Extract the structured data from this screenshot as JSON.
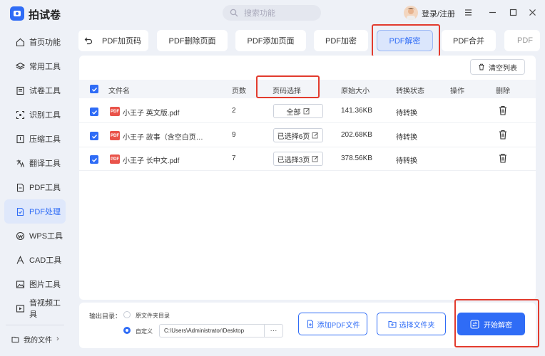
{
  "app": {
    "title": "拍试卷",
    "search_placeholder": "搜索功能",
    "login": "登录/注册"
  },
  "sidebar": {
    "items": [
      {
        "label": "首页功能",
        "icon": "home-icon"
      },
      {
        "label": "常用工具",
        "icon": "layers-icon"
      },
      {
        "label": "试卷工具",
        "icon": "exam-icon"
      },
      {
        "label": "识别工具",
        "icon": "scan-icon"
      },
      {
        "label": "压缩工具",
        "icon": "compress-icon"
      },
      {
        "label": "翻译工具",
        "icon": "translate-icon"
      },
      {
        "label": "PDF工具",
        "icon": "pdf-icon"
      },
      {
        "label": "PDF处理",
        "icon": "pdf-process-icon"
      },
      {
        "label": "WPS工具",
        "icon": "wps-icon"
      },
      {
        "label": "CAD工具",
        "icon": "cad-icon"
      },
      {
        "label": "图片工具",
        "icon": "image-icon"
      },
      {
        "label": "音视频工具",
        "icon": "media-icon"
      }
    ],
    "active_index": 7,
    "my_files": "我的文件"
  },
  "tabs": [
    "PDF加页码",
    "PDF删除页面",
    "PDF添加页面",
    "PDF加密",
    "PDF解密",
    "PDF合并",
    "PDF"
  ],
  "active_tab": 4,
  "panel": {
    "clear_label": "清空列表",
    "headers": {
      "name": "文件名",
      "pages": "页数",
      "page_select": "页码选择",
      "size": "原始大小",
      "status": "转换状态",
      "action": "操作",
      "delete": "删除"
    },
    "rows": [
      {
        "name": "小王子 英文版.pdf",
        "pages": "2",
        "page_select": "全部",
        "size": "141.36KB",
        "status": "待转换"
      },
      {
        "name": "小王子 故事（含空白页…",
        "pages": "9",
        "page_select": "已选择6页",
        "size": "202.68KB",
        "status": "待转换"
      },
      {
        "name": "小王子 长中文.pdf",
        "pages": "7",
        "page_select": "已选择3页",
        "size": "378.56KB",
        "status": "待转换"
      }
    ]
  },
  "bottom": {
    "output_label": "输出目录：",
    "opt_source": "原文件夹目录",
    "opt_custom": "自定义",
    "path": "C:\\Users\\Administrator\\Desktop",
    "dots": "···",
    "add_pdf": "添加PDF文件",
    "choose_folder": "选择文件夹",
    "start": "开始解密"
  },
  "colors": {
    "accent": "#2f6cf6",
    "highlight": "#e23b2e"
  }
}
